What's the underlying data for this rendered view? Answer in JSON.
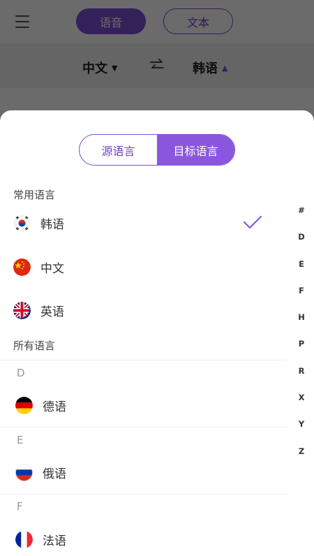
{
  "topbar": {
    "menu_icon": "hamburger-menu-icon",
    "mode_voice": "语音",
    "mode_text": "文本"
  },
  "langbar": {
    "source": "中文",
    "target": "韩语",
    "swap_icon": "swap-arrows-icon"
  },
  "sheet": {
    "tabs": [
      {
        "label": "源语言",
        "active": false
      },
      {
        "label": "目标语言",
        "active": true
      }
    ],
    "common_title": "常用语言",
    "common": [
      {
        "label": "韩语",
        "flag": "korea-flag-icon",
        "selected": true
      },
      {
        "label": "中文",
        "flag": "china-flag-icon",
        "selected": false
      },
      {
        "label": "英语",
        "flag": "uk-flag-icon",
        "selected": false
      }
    ],
    "all_title": "所有语言",
    "groups": [
      {
        "letter": "D",
        "items": [
          {
            "label": "德语",
            "flag": "germany-flag-icon"
          }
        ]
      },
      {
        "letter": "E",
        "items": [
          {
            "label": "俄语",
            "flag": "russia-flag-icon"
          }
        ]
      },
      {
        "letter": "F",
        "items": [
          {
            "label": "法语",
            "flag": "france-flag-icon"
          }
        ]
      }
    ],
    "index": [
      "#",
      "D",
      "E",
      "F",
      "H",
      "P",
      "R",
      "X",
      "Y",
      "Z"
    ]
  },
  "colors": {
    "accent": "#7e4fd6",
    "overlay": "rgba(0,0,0,0.58)"
  }
}
